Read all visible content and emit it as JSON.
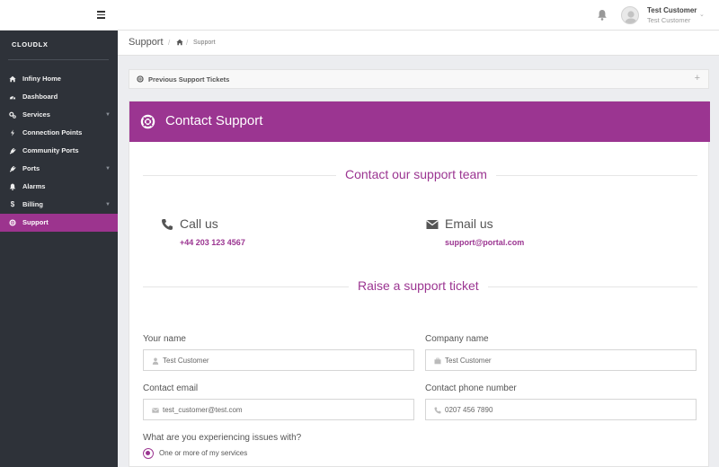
{
  "header": {
    "user_name": "Test Customer",
    "user_role": "Test Customer"
  },
  "sidebar": {
    "brand": "CLOUDLX",
    "items": [
      {
        "label": "Infiny Home",
        "icon": "home-icon"
      },
      {
        "label": "Dashboard",
        "icon": "dashboard-icon"
      },
      {
        "label": "Services",
        "icon": "cogs-icon",
        "caret": true
      },
      {
        "label": "Connection Points",
        "icon": "bolt-icon"
      },
      {
        "label": "Community Ports",
        "icon": "plug-icon"
      },
      {
        "label": "Ports",
        "icon": "plug-icon",
        "caret": true
      },
      {
        "label": "Alarms",
        "icon": "bell-icon"
      },
      {
        "label": "Billing",
        "icon": "dollar-icon",
        "caret": true
      },
      {
        "label": "Support",
        "icon": "life-ring-icon",
        "active": true
      }
    ]
  },
  "breadcrumb": {
    "title": "Support",
    "current": "Support"
  },
  "previous_tickets": {
    "title": "Previous Support Tickets",
    "toggle": "+"
  },
  "contact_panel": {
    "title": "Contact Support",
    "contact_team_heading": "Contact our support team",
    "call_label": "Call us",
    "phone": "+44 203 123 4567",
    "email_label": "Email us",
    "email": "support@portal.com",
    "ticket_heading": "Raise a support ticket"
  },
  "form": {
    "name_label": "Your name",
    "name_value": "Test Customer",
    "company_label": "Company name",
    "company_value": "Test Customer",
    "email_label": "Contact email",
    "email_value": "test_customer@test.com",
    "phone_label": "Contact phone number",
    "phone_value": "0207 456 7890",
    "issue_question": "What are you experiencing issues with?",
    "issue_option_1": "One or more of my services"
  },
  "colors": {
    "accent": "#9b3591",
    "sidebar_bg": "#2e3239",
    "page_bg": "#ecedf0"
  }
}
